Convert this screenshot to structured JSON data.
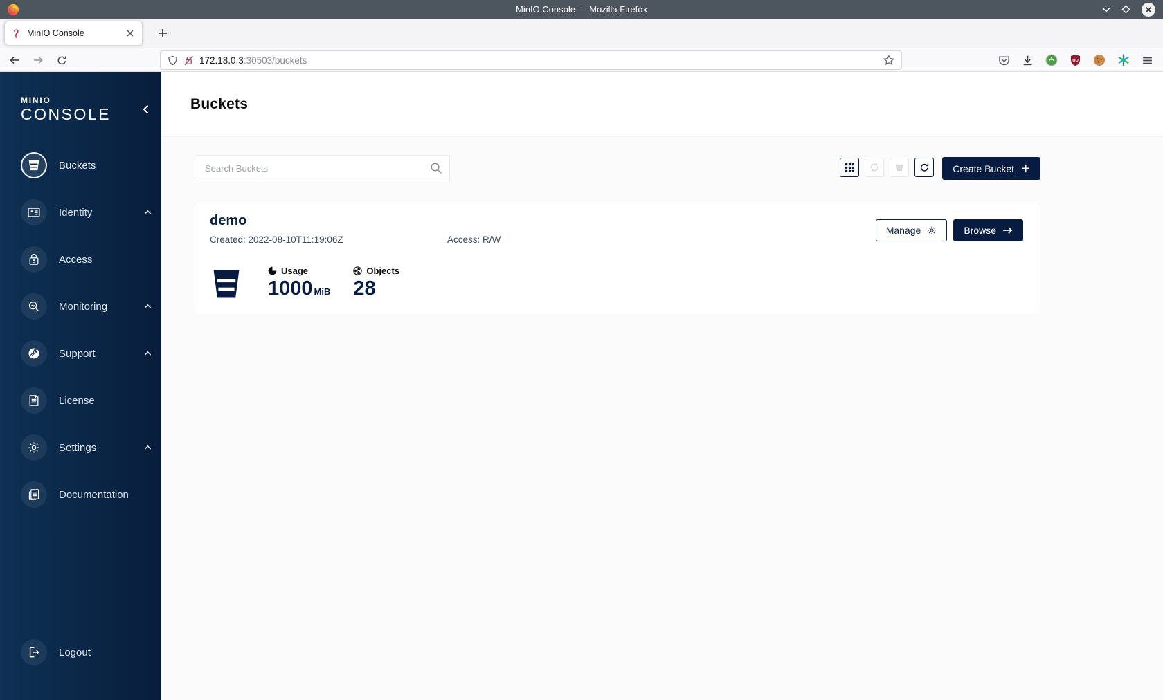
{
  "colors": {
    "primary_navy": "#081C42",
    "sidebar_gradient_from": "#0E3155",
    "sidebar_gradient_to": "#081D3B",
    "minio_brand_red": "#C72C48"
  },
  "window": {
    "title": "MinIO Console — Mozilla Firefox"
  },
  "browser": {
    "tab_title": "MinIO Console",
    "url_host": "172.18.0.3",
    "url_rest": ":30503/buckets",
    "extension_badge": "UD",
    "toolbar_icons": [
      "pocket-icon",
      "downloads-icon",
      "extension-green-icon",
      "extension-shield-icon",
      "extension-cookie-icon",
      "extension-asterisk-icon",
      "menu-icon"
    ]
  },
  "sidebar": {
    "brand_top": "MINIO",
    "brand_bottom": "CONSOLE",
    "items": [
      {
        "label": "Buckets",
        "icon": "bucket-icon",
        "active": true
      },
      {
        "label": "Identity",
        "icon": "identity-card-icon",
        "expandable": true
      },
      {
        "label": "Access",
        "icon": "lock-user-icon"
      },
      {
        "label": "Monitoring",
        "icon": "magnifier-icon",
        "expandable": true
      },
      {
        "label": "Support",
        "icon": "wrench-circle-icon",
        "expandable": true
      },
      {
        "label": "License",
        "icon": "license-doc-icon"
      },
      {
        "label": "Settings",
        "icon": "gear-icon",
        "expandable": true
      },
      {
        "label": "Documentation",
        "icon": "documentation-icon"
      }
    ],
    "logout_label": "Logout"
  },
  "page": {
    "title": "Buckets",
    "search_placeholder": "Search Buckets",
    "create_bucket_label": "Create Bucket",
    "bucket": {
      "name": "demo",
      "created_text": "Created: 2022-08-10T11:19:06Z",
      "access_text": "Access: R/W",
      "manage_label": "Manage",
      "browse_label": "Browse",
      "usage_label": "Usage",
      "usage_value": "1000",
      "usage_unit": "MiB",
      "objects_label": "Objects",
      "objects_value": "28"
    }
  }
}
